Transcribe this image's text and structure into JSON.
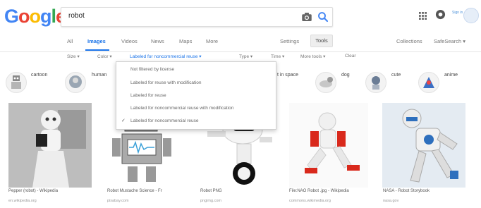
{
  "header": {
    "logo": [
      "G",
      "o",
      "o",
      "g",
      "l",
      "e"
    ],
    "logo_colors": [
      "#4285F4",
      "#EA4335",
      "#FBBC05",
      "#4285F4",
      "#34A853",
      "#EA4335"
    ],
    "search_query": "robot",
    "sign_in_text": "Sign in"
  },
  "tabs": [
    "All",
    "Images",
    "Videos",
    "News",
    "Maps",
    "More"
  ],
  "right_tabs": {
    "settings": "Settings",
    "tools": "Tools",
    "collections": "Collections",
    "safesearch": "SafeSearch ▾"
  },
  "tools_row": {
    "size": "Size ▾",
    "color": "Color ▾",
    "usage": "Labeled for noncommercial reuse ▾",
    "type": "Type ▾",
    "time": "Time ▾",
    "more_tools": "More tools ▾",
    "clear": "Clear"
  },
  "dropdown": {
    "items": [
      "Not filtered by license",
      "Labeled for reuse with modification",
      "Labeled for reuse",
      "Labeled for noncommercial reuse with modification",
      "Labeled for noncommercial reuse"
    ],
    "checked_index": 4,
    "check_mark": "✓"
  },
  "chips": [
    "cartoon",
    "human",
    "t in space",
    "dog",
    "cute",
    "anime"
  ],
  "images": [
    {
      "caption": "Pepper (robot) - Wikipedia",
      "source": "en.wikipedia.org"
    },
    {
      "caption": "Robot Mustache Science - Fr",
      "source": "pixabay.com"
    },
    {
      "caption": "Robot PNG",
      "source": "pngimg.com"
    },
    {
      "caption": "File:NAO Robot .jpg - Wikipedia",
      "source": "commons.wikimedia.org"
    },
    {
      "caption": "NASA - Robot Storybook",
      "source": "nasa.gov"
    }
  ],
  "colors": {
    "accent": "#1a73e8",
    "robot_red": "#d9291c",
    "robot_blue": "#2e6fbd"
  }
}
